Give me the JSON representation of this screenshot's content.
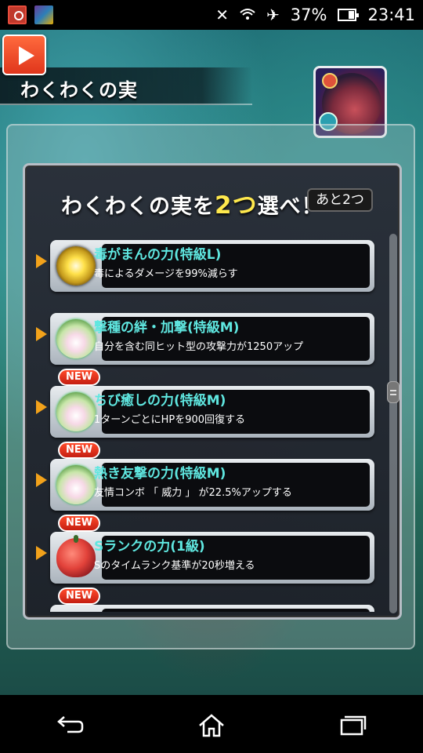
{
  "status_bar": {
    "battery_percent": "37%",
    "time": "23:41",
    "icons": [
      "camera-app-icon",
      "game-app-icon",
      "no-mobile-data-icon",
      "wifi-icon",
      "airplane-mode-icon",
      "battery-icon"
    ]
  },
  "header": {
    "title": "わくわくの実",
    "play_icon": "play-icon"
  },
  "panel": {
    "heading_prefix": "わくわくの実を",
    "heading_highlight": "2つ",
    "heading_suffix": "選べ！",
    "remaining_label": "あと2つ"
  },
  "items": [
    {
      "name": "毒がまんの力(特級L)",
      "desc": "毒によるダメージを99%減らす",
      "new": "",
      "icon": "gold-fruit-icon"
    },
    {
      "name": "撃種の絆・加撃(特級M)",
      "desc": "自分を含む同ヒット型の攻撃力が1250アップ",
      "new": "",
      "icon": "leaf-fruit-icon"
    },
    {
      "name": "ちび癒しの力(特級M)",
      "desc": "1ターンごとにHPを900回復する",
      "new": "NEW",
      "icon": "leaf-fruit-icon"
    },
    {
      "name": "熱き友撃の力(特級M)",
      "desc": "友情コンボ 「 威力 」 が22.5%アップする",
      "new": "NEW",
      "icon": "leaf-fruit-icon"
    },
    {
      "name": "Sランクの力(1級)",
      "desc": "Sのタイムランク基準が20秒増える",
      "new": "NEW",
      "icon": "red-fruit-icon"
    },
    {
      "name": "",
      "desc": "",
      "new": "NEW",
      "icon": ""
    }
  ],
  "nav": [
    "back-icon",
    "home-icon",
    "recent-apps-icon"
  ],
  "colors": {
    "accent_cyan": "#5fe7e0",
    "highlight_yellow": "#ffe94d",
    "new_red": "#c41e12"
  }
}
